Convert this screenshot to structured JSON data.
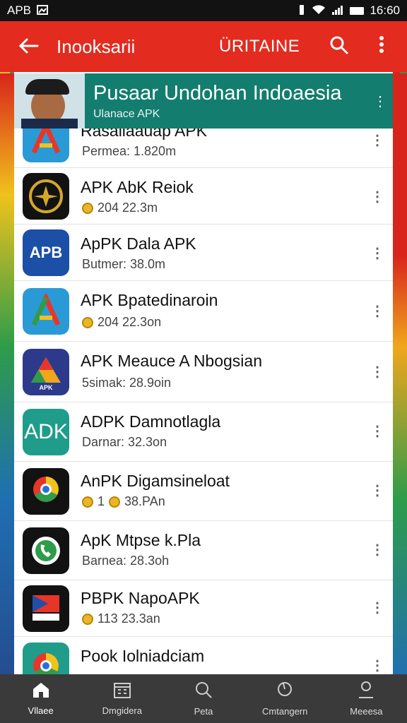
{
  "status_bar": {
    "carrier": "APB",
    "time": "16:60",
    "icons": [
      "image-icon",
      "vibrate-icon",
      "wifi-icon",
      "signal-icon",
      "battery-icon"
    ]
  },
  "app_bar": {
    "title": "Inooksarii",
    "subtitle": "ÜRITAINE",
    "icons": [
      "back-arrow-icon",
      "search-icon",
      "more-vert-icon"
    ]
  },
  "banner": {
    "title": "Pusaar Undohan Indoaesia",
    "subtitle": "Ulanace APK"
  },
  "apps": [
    {
      "name": "Rasaliaauap APK",
      "meta": "Permea: 1.820m",
      "coin": false,
      "icon": "colored-a-icon"
    },
    {
      "name": "APK AbK Reiok",
      "meta": "204 22.3m",
      "coin": true,
      "icon": "garuda-emblem-icon"
    },
    {
      "name": "ApPK Dala APK",
      "meta": "Butmer: 38.0m",
      "coin": false,
      "icon": "apb-text-icon"
    },
    {
      "name": "APK Bpatedinaroin",
      "meta": "204 22.3on",
      "coin": true,
      "icon": "colored-a-icon"
    },
    {
      "name": "APK Meauce A Nbogsian",
      "meta": "5simak: 28.9oin",
      "coin": false,
      "icon": "apk-triangle-icon"
    },
    {
      "name": "ADPK Damnotlagla",
      "meta": "Darnar: 32.3on",
      "coin": false,
      "icon": "adk-text-icon"
    },
    {
      "name": "AnPK Digamsineloat",
      "meta": "1",
      "meta2": "38.PAn",
      "coin": true,
      "icon": "chrome-wreath-icon"
    },
    {
      "name": "ApK Mtpse k.Pla",
      "meta": "Barnea: 28.3oh",
      "coin": false,
      "icon": "phone-chat-icon"
    },
    {
      "name": "PBPK NapoAPK",
      "meta": "113 23.3an",
      "coin": true,
      "icon": "flag-stack-icon"
    },
    {
      "name": "Pook Iolniadciam",
      "meta": "",
      "coin": false,
      "icon": "chrome-icon"
    }
  ],
  "bottom_nav": [
    {
      "label": "Vllaee",
      "icon": "home-icon"
    },
    {
      "label": "Dmgidera",
      "icon": "calendar-icon"
    },
    {
      "label": "Peta",
      "icon": "search-icon"
    },
    {
      "label": "Cmtangern",
      "icon": "location-icon"
    },
    {
      "label": "Meeesa",
      "icon": "profile-icon"
    }
  ],
  "colors": {
    "app_bar": "#e32b1f",
    "banner": "#137d6f",
    "bottom_nav": "#3a3a3a"
  }
}
